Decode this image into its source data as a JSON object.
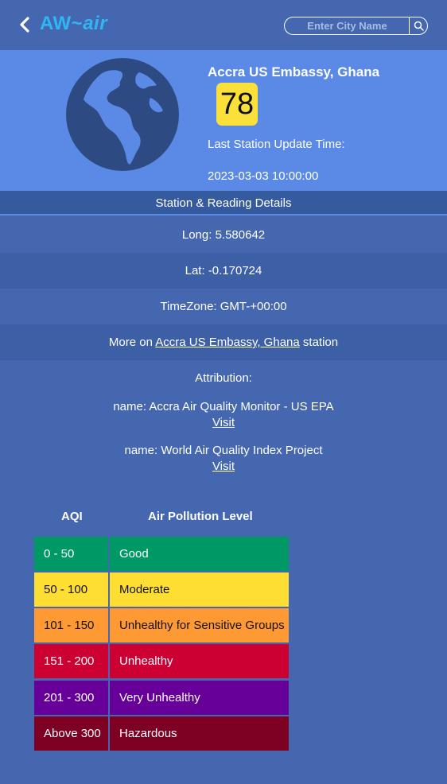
{
  "header": {
    "logo_prefix": "AW~",
    "logo_suffix": "air",
    "search_placeholder": "Enter City Name",
    "logo_color": "#2fb6f3"
  },
  "station": {
    "name": "Accra US Embassy, Ghana",
    "aqi": "78",
    "aqi_color": "#fce03a",
    "update_label": "Last Station Update Time:",
    "update_time": "2023-03-03 10:00:00"
  },
  "details": {
    "header": "Station & Reading Details",
    "long": "Long: 5.580642",
    "lat": "Lat: -0.170724",
    "timezone": "TimeZone: GMT-+00:00",
    "more_prefix": "More on",
    "more_link": "Accra US Embassy, Ghana",
    "more_suffix": "station"
  },
  "attribution": {
    "title": "Attribution:",
    "items": [
      {
        "name": "name: Accra Air Quality Monitor - US EPA",
        "link": "Visit"
      },
      {
        "name": "name: World Air Quality Index Project",
        "link": "Visit"
      }
    ]
  },
  "legend": {
    "col_aqi": "AQI",
    "col_level": "Air Pollution Level",
    "rows": [
      {
        "range": "0 - 50",
        "level": "Good",
        "color": "#009966",
        "text": "#ffffff"
      },
      {
        "range": "50 - 100",
        "level": "Moderate",
        "color": "#ffde33",
        "text": "#111111"
      },
      {
        "range": "101 - 150",
        "level": "Unhealthy for Sensitive Groups",
        "color": "#ff9933",
        "text": "#111111"
      },
      {
        "range": "151 - 200",
        "level": "Unhealthy",
        "color": "#cc0033",
        "text": "#ffffff"
      },
      {
        "range": "201 - 300",
        "level": "Very Unhealthy",
        "color": "#660099",
        "text": "#ffffff"
      },
      {
        "range": "Above 300",
        "level": "Hazardous",
        "color": "#7e0023",
        "text": "#ffffff"
      }
    ]
  },
  "icons": {
    "back": "chevron-left-icon",
    "search": "search-icon",
    "globe": "globe-icon"
  }
}
